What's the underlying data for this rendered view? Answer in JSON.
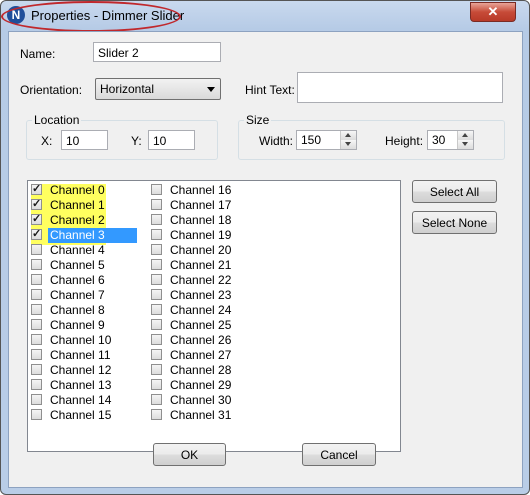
{
  "window": {
    "title": "Properties - Dimmer Slider",
    "app_icon": "N",
    "close_glyph": "✕"
  },
  "form": {
    "name_label": "Name:",
    "name_value": "Slider 2",
    "orientation_label": "Orientation:",
    "orientation_value": "Horizontal",
    "hint_label": "Hint Text:",
    "hint_value": "",
    "location": {
      "title": "Location",
      "x_label": "X:",
      "x_value": "10",
      "y_label": "Y:",
      "y_value": "10"
    },
    "size": {
      "title": "Size",
      "width_label": "Width:",
      "width_value": "150",
      "height_label": "Height:",
      "height_value": "30"
    }
  },
  "channels": [
    {
      "label": "Channel 0",
      "checked": true
    },
    {
      "label": "Channel 1",
      "checked": true
    },
    {
      "label": "Channel 2",
      "checked": true
    },
    {
      "label": "Channel 3",
      "checked": true
    },
    {
      "label": "Channel 4",
      "checked": false
    },
    {
      "label": "Channel 5",
      "checked": false
    },
    {
      "label": "Channel 6",
      "checked": false
    },
    {
      "label": "Channel 7",
      "checked": false
    },
    {
      "label": "Channel 8",
      "checked": false
    },
    {
      "label": "Channel 9",
      "checked": false
    },
    {
      "label": "Channel 10",
      "checked": false
    },
    {
      "label": "Channel 11",
      "checked": false
    },
    {
      "label": "Channel 12",
      "checked": false
    },
    {
      "label": "Channel 13",
      "checked": false
    },
    {
      "label": "Channel 14",
      "checked": false
    },
    {
      "label": "Channel 15",
      "checked": false
    },
    {
      "label": "Channel 16",
      "checked": false
    },
    {
      "label": "Channel 17",
      "checked": false
    },
    {
      "label": "Channel 18",
      "checked": false
    },
    {
      "label": "Channel 19",
      "checked": false
    },
    {
      "label": "Channel 20",
      "checked": false
    },
    {
      "label": "Channel 21",
      "checked": false
    },
    {
      "label": "Channel 22",
      "checked": false
    },
    {
      "label": "Channel 23",
      "checked": false
    },
    {
      "label": "Channel 24",
      "checked": false
    },
    {
      "label": "Channel 25",
      "checked": false
    },
    {
      "label": "Channel 26",
      "checked": false
    },
    {
      "label": "Channel 27",
      "checked": false
    },
    {
      "label": "Channel 28",
      "checked": false
    },
    {
      "label": "Channel 29",
      "checked": false
    },
    {
      "label": "Channel 30",
      "checked": false
    },
    {
      "label": "Channel 31",
      "checked": false
    }
  ],
  "selected_channel": "Channel 3",
  "buttons": {
    "select_all": "Select All",
    "select_none": "Select None",
    "ok": "OK",
    "cancel": "Cancel"
  },
  "colors": {
    "selection": "#3399ff",
    "highlight": "#ffff2a",
    "title_oval": "#c0282c"
  }
}
